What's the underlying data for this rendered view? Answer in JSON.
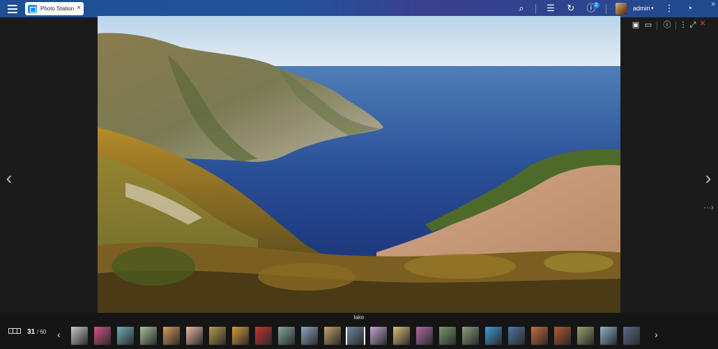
{
  "topbar": {
    "app_tab": {
      "name": "Photo Station",
      "close": "×"
    },
    "icons": {
      "search": "⌕",
      "tasks": "☰",
      "sync": "↻",
      "info": "ⓘ",
      "more": "⋮",
      "dashboard": "◔"
    },
    "notification_count": "2",
    "user": {
      "name": "admin",
      "caret": "▾"
    },
    "window_close": "✕"
  },
  "viewer": {
    "toolbar_icons": {
      "face": "☺",
      "download": "⤓",
      "share": "⋰",
      "slideshow": "▣",
      "screen": "▭",
      "info": "ⓘ",
      "more": "⋮",
      "fullscreen": "⤢",
      "close": "✕"
    },
    "prev": "‹",
    "next": "›",
    "more": "···›",
    "caption": "lake"
  },
  "filmstrip": {
    "current": "31",
    "total": "/ 60",
    "prev": "‹",
    "next": "›",
    "active_index": 12,
    "thumbnails": [
      "#c9c9c9",
      "#d74f8a",
      "#6fb0b8",
      "#a7c09a",
      "#d89a58",
      "#e8b9a5",
      "#b79b4c",
      "#d79a38",
      "#c8342f",
      "#7fa8a0",
      "#8fa7c4",
      "#c2a26a",
      "#6a86a3",
      "#c4a4d0",
      "#d7c07a",
      "#b06aa8",
      "#7a9a6a",
      "#8aa07a",
      "#3d9bd4",
      "#4c77a3",
      "#c96a3a",
      "#b5582d",
      "#9aa36a",
      "#8fb0c8",
      "#5a6a8a"
    ]
  }
}
